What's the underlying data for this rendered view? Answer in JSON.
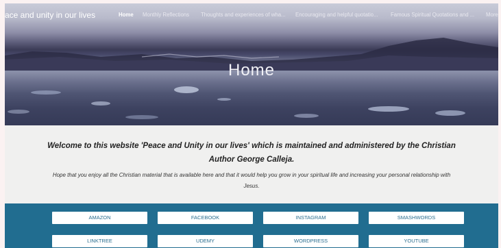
{
  "header": {
    "site_title": "ace and unity in our lives",
    "nav": [
      {
        "label": "Home",
        "active": true
      },
      {
        "label": "Monthly Reflections",
        "active": false
      },
      {
        "label": "Thoughts and experiences of wha...",
        "active": false
      },
      {
        "label": "Encouraging and helpful quotatio...",
        "active": false
      },
      {
        "label": "Famous Spiritual Quotations and ...",
        "active": false
      },
      {
        "label": "More",
        "active": false
      }
    ]
  },
  "hero": {
    "title": "Home"
  },
  "intro": {
    "welcome": "Welcome to this website 'Peace and Unity in our lives' which is maintained and administered by the Christian Author George Calleja.",
    "hope": "Hope that you enjoy all the Christian material that is available here and that it would help you grow in your spiritual life and increasing your personal relationship with Jesus."
  },
  "links": {
    "buttons": [
      "AMAZON",
      "FACEBOOK",
      "INSTAGRAM",
      "SMASHWORDS",
      "LINKTREE",
      "UDEMY",
      "WORDPRESS",
      "YOUTUBE"
    ]
  },
  "colors": {
    "links_band": "#216d90",
    "button_text": "#2a6d8f",
    "page_bg": "#f0f0ef"
  }
}
